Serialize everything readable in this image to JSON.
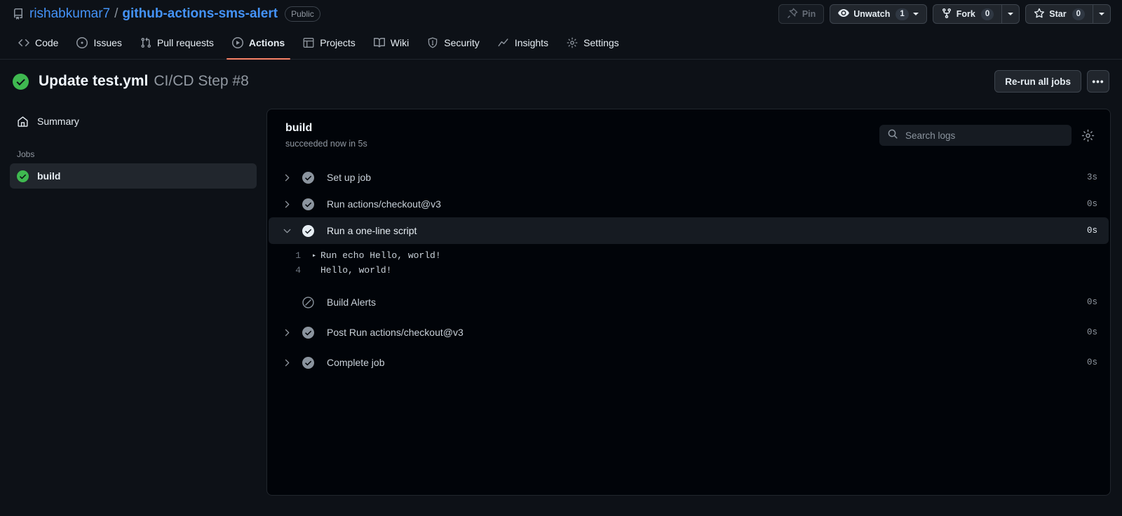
{
  "repo": {
    "icon": "repo-icon",
    "owner": "rishabkumar7",
    "separator": "/",
    "name": "github-actions-sms-alert",
    "visibility": "Public"
  },
  "header_actions": {
    "pin": {
      "label": "Pin",
      "icon": "pin-icon"
    },
    "watch": {
      "label": "Unwatch",
      "count": "1",
      "icon": "eye-icon"
    },
    "fork": {
      "label": "Fork",
      "count": "0",
      "icon": "fork-icon"
    },
    "star": {
      "label": "Star",
      "count": "0",
      "icon": "star-icon"
    }
  },
  "nav": {
    "tabs": [
      {
        "label": "Code",
        "icon": "code-icon",
        "active": false
      },
      {
        "label": "Issues",
        "icon": "issue-opened-icon",
        "active": false
      },
      {
        "label": "Pull requests",
        "icon": "git-pull-request-icon",
        "active": false
      },
      {
        "label": "Actions",
        "icon": "play-icon",
        "active": true
      },
      {
        "label": "Projects",
        "icon": "table-icon",
        "active": false
      },
      {
        "label": "Wiki",
        "icon": "book-icon",
        "active": false
      },
      {
        "label": "Security",
        "icon": "shield-icon",
        "active": false
      },
      {
        "label": "Insights",
        "icon": "graph-icon",
        "active": false
      },
      {
        "label": "Settings",
        "icon": "gear-icon",
        "active": false
      }
    ]
  },
  "run": {
    "status_icon": "check-circle-fill-icon",
    "title": "Update test.yml",
    "workflow": "CI/CD Step #8",
    "rerun_label": "Re-run all jobs",
    "overflow_label": "•••"
  },
  "sidebar": {
    "summary_label": "Summary",
    "summary_icon": "home-icon",
    "jobs_heading": "Jobs",
    "jobs": [
      {
        "label": "build",
        "icon": "check-circle-fill-icon",
        "selected": true
      }
    ]
  },
  "job": {
    "name": "build",
    "status": "succeeded now in 5s",
    "search_placeholder": "Search logs",
    "search_value": "",
    "search_icon": "search-icon",
    "settings_icon": "gear-icon"
  },
  "steps": [
    {
      "label": "Set up job",
      "icon": "check",
      "duration": "3s",
      "expanded": false,
      "has_chevron": true
    },
    {
      "label": "Run actions/checkout@v3",
      "icon": "check",
      "duration": "0s",
      "expanded": false,
      "has_chevron": true
    },
    {
      "label": "Run a one-line script",
      "icon": "check",
      "duration": "0s",
      "expanded": true,
      "has_chevron": true
    },
    {
      "label": "Build Alerts",
      "icon": "skipped",
      "duration": "0s",
      "expanded": false,
      "has_chevron": false
    },
    {
      "label": "Post Run actions/checkout@v3",
      "icon": "check",
      "duration": "0s",
      "expanded": false,
      "has_chevron": true
    },
    {
      "label": "Complete job",
      "icon": "check",
      "duration": "0s",
      "expanded": false,
      "has_chevron": true
    }
  ],
  "log_lines": [
    {
      "number": "1",
      "marker": "▸",
      "text": "Run echo Hello, world!"
    },
    {
      "number": "4",
      "marker": "",
      "text": "Hello, world!"
    }
  ],
  "colors": {
    "accent_link": "#4493f8",
    "success_green": "#3fb950",
    "active_tab_underline": "#f78166",
    "page_bg": "#0d1117",
    "panel_bg": "#010409"
  }
}
